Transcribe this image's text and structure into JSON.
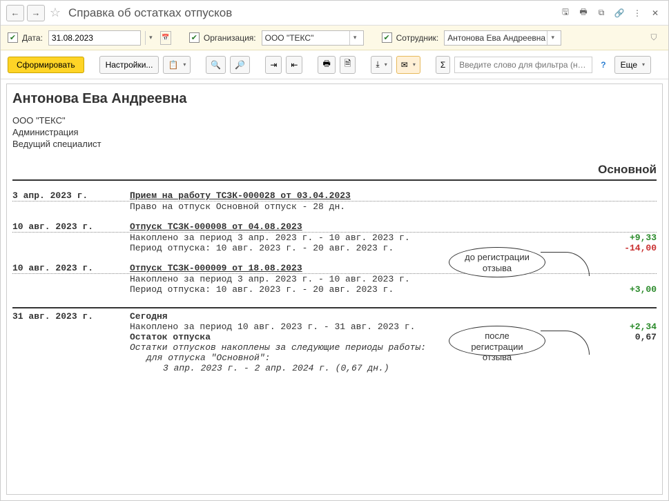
{
  "header": {
    "title": "Справка об остатках отпусков"
  },
  "filters": {
    "date_label": "Дата:",
    "date_value": "31.08.2023",
    "org_label": "Организация:",
    "org_value": "ООО \"ТЕКС\"",
    "emp_label": "Сотрудник:",
    "emp_value": "Антонова Ева Андреевна"
  },
  "toolbar": {
    "form_label": "Сформировать",
    "settings_label": "Настройки...",
    "sigma_label": "Σ",
    "filter_placeholder": "Введите слово для фильтра (н…",
    "more_label": "Еще"
  },
  "report": {
    "employee": "Антонова Ева Андреевна",
    "org": "ООО \"ТЕКС\"",
    "dept": "Администрация",
    "position": "Ведущий специалист",
    "righthdr": "Основной",
    "blocks": [
      {
        "date": "3 апр. 2023 г.",
        "title": "Прием на работу ТСЗК-000028 от 03.04.2023",
        "lines": [
          "Право на отпуск Основной отпуск - 28 дн."
        ],
        "values": []
      },
      {
        "date": "10 авг. 2023 г.",
        "title": "Отпуск ТСЗК-000008 от 04.08.2023",
        "lines": [
          "Накоплено за период 3 апр. 2023 г. - 10 авг. 2023 г.",
          "Период отпуска: 10 авг. 2023 г. - 20 авг. 2023 г."
        ],
        "values": [
          {
            "text": "+9,33",
            "cls": "green"
          },
          {
            "text": "-14,00",
            "cls": "red"
          }
        ]
      },
      {
        "date": "10 авг. 2023 г.",
        "title": "Отпуск ТСЗК-000009 от 18.08.2023",
        "lines": [
          "Накоплено за период 3 апр. 2023 г. - 10 авг. 2023 г.",
          "Период отпуска: 10 авг. 2023 г. - 20 авг. 2023 г."
        ],
        "values": [
          {
            "text": "",
            "cls": ""
          },
          {
            "text": "+3,00",
            "cls": "green"
          }
        ]
      }
    ],
    "today": {
      "date": "31 авг. 2023 г.",
      "today_label": "Сегодня",
      "accum": "Накоплено за период 10 авг. 2023 г. - 31 авг. 2023 г.",
      "accum_val": "+2,34",
      "remain_label": "Остаток отпуска",
      "remain_val": "0,67",
      "note1": "Остатки отпусков накоплены за следующие периоды работы:",
      "note2": "для отпуска \"Основной\":",
      "note3": "3 апр. 2023 г. - 2 апр. 2024 г. (0,67 дн.)"
    }
  },
  "callouts": {
    "c1": "до регистрации отзыва",
    "c2": "после регистрации отзыва"
  }
}
